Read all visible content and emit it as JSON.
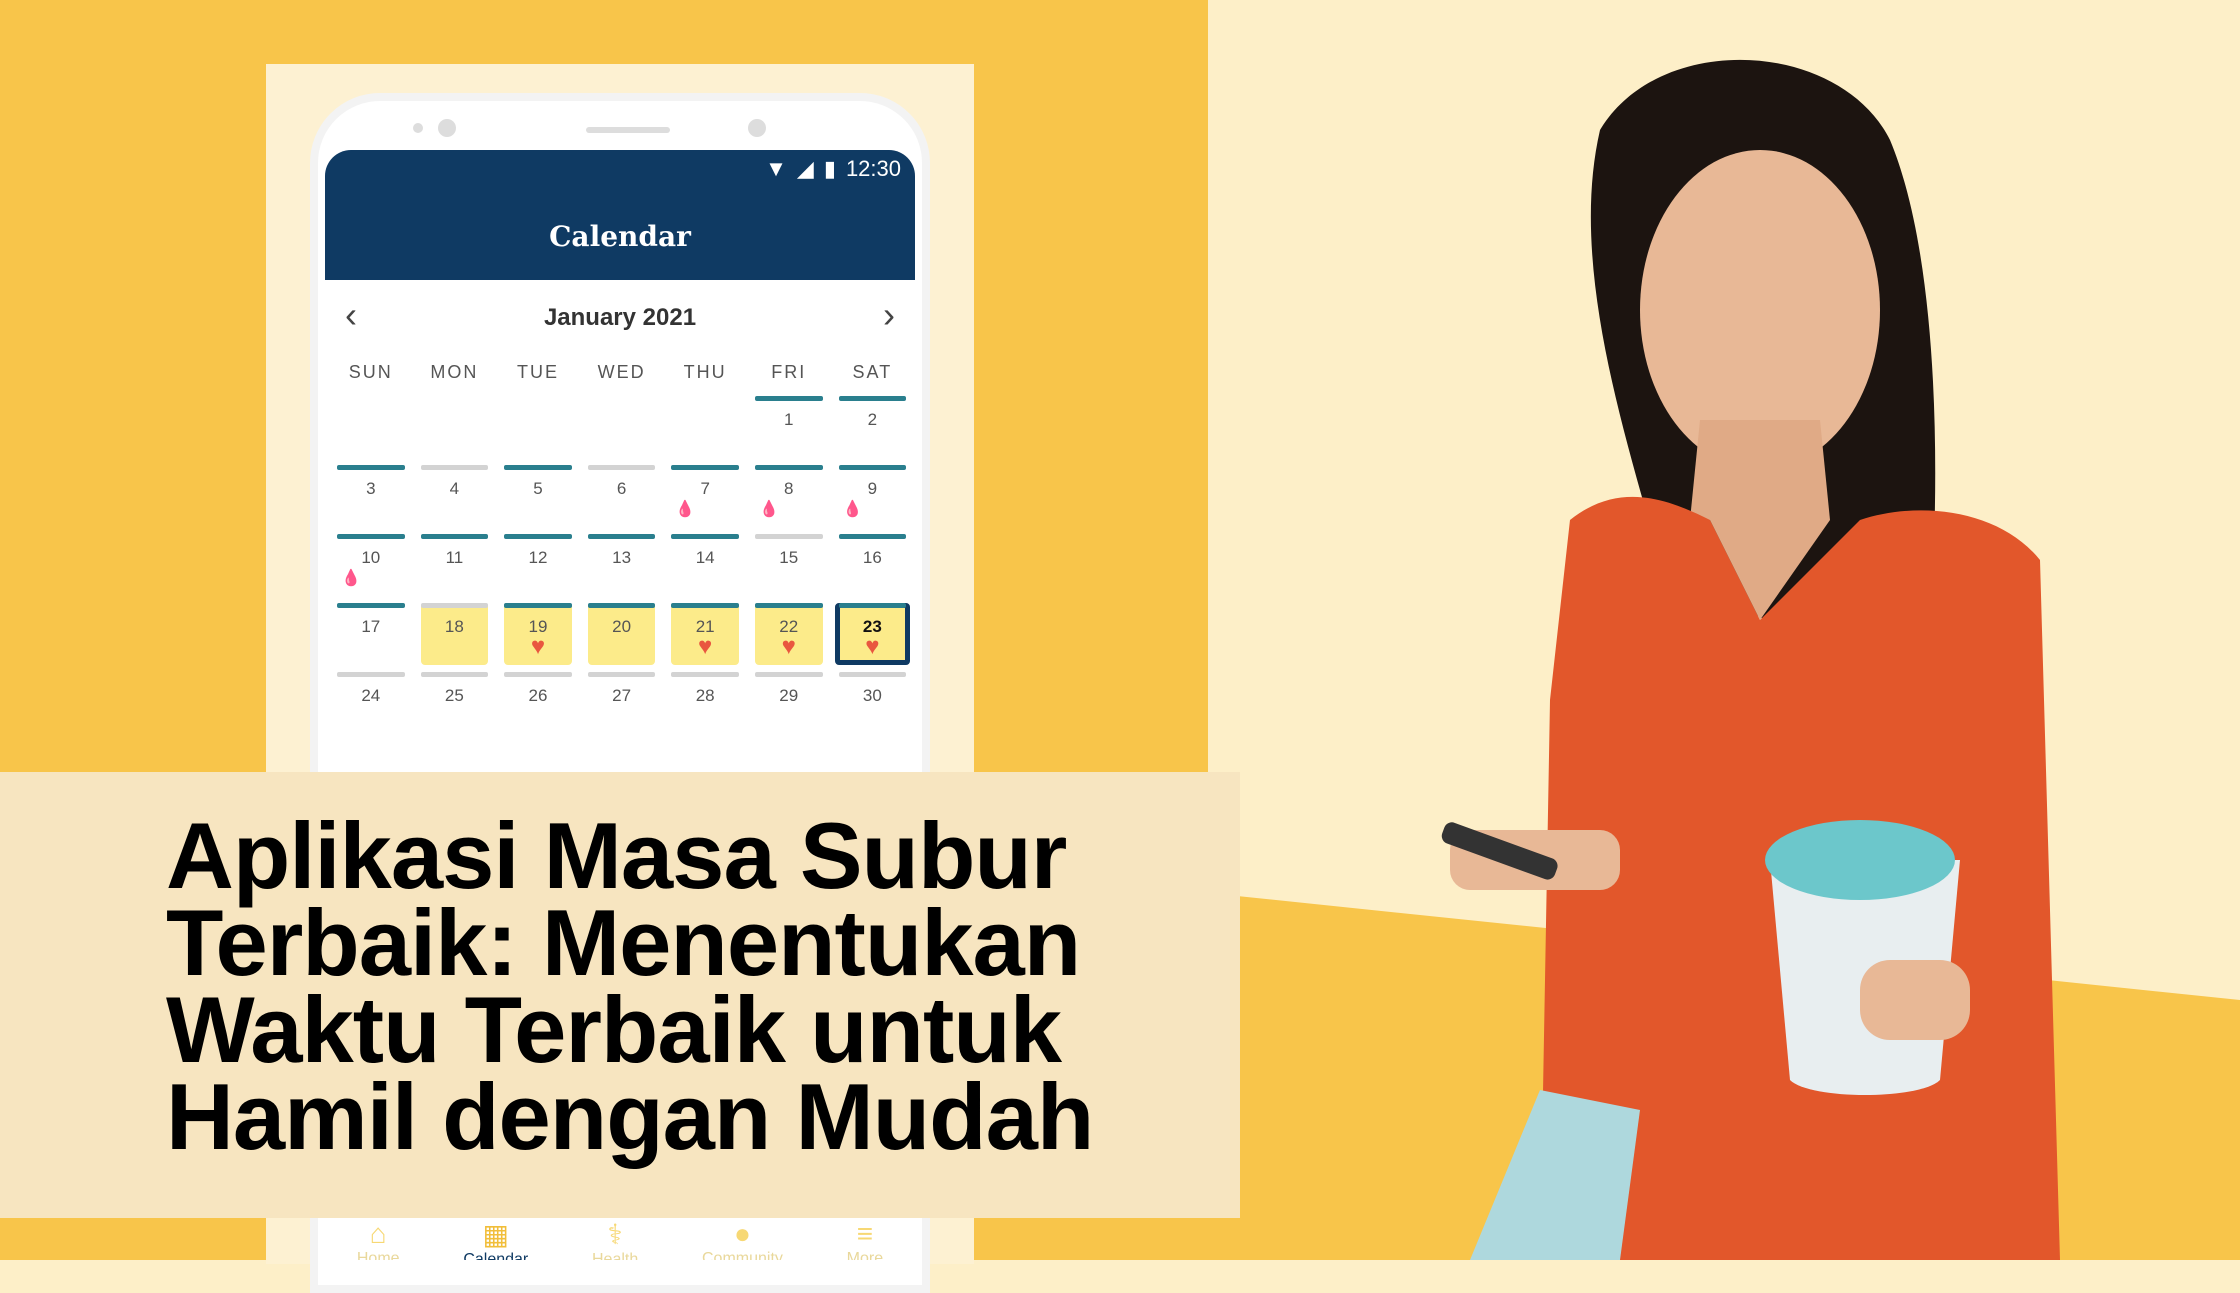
{
  "colors": {
    "left_bg": "#F8C54A",
    "right_bg": "#FDEFC8",
    "app_bar": "#0F3A63",
    "teal": "#2A7F8E",
    "gray": "#D3D3D3",
    "fertile": "#FCEB8A",
    "heart": "#E9573F",
    "drop": "#A11111"
  },
  "phone": {
    "status": {
      "time": "12:30",
      "icons": [
        "wifi-icon",
        "signal-icon",
        "battery-icon"
      ]
    },
    "app_title": "Calendar",
    "month": "January 2021",
    "prev_icon": "chevron-left-icon",
    "next_icon": "chevron-right-icon",
    "weekdays": [
      "SUN",
      "MON",
      "TUE",
      "WED",
      "THU",
      "FRI",
      "SAT"
    ],
    "days": [
      {
        "d": ""
      },
      {
        "d": ""
      },
      {
        "d": ""
      },
      {
        "d": ""
      },
      {
        "d": ""
      },
      {
        "d": "1",
        "bar": "teal"
      },
      {
        "d": "2",
        "bar": "teal"
      },
      {
        "d": "3",
        "bar": "teal"
      },
      {
        "d": "4",
        "bar": "gray"
      },
      {
        "d": "5",
        "bar": "teal"
      },
      {
        "d": "6",
        "bar": "gray"
      },
      {
        "d": "7",
        "bar": "teal",
        "drop": true
      },
      {
        "d": "8",
        "bar": "teal",
        "drop": true
      },
      {
        "d": "9",
        "bar": "teal",
        "drop": true
      },
      {
        "d": "10",
        "bar": "teal",
        "drop": true
      },
      {
        "d": "11",
        "bar": "teal"
      },
      {
        "d": "12",
        "bar": "teal"
      },
      {
        "d": "13",
        "bar": "teal"
      },
      {
        "d": "14",
        "bar": "teal"
      },
      {
        "d": "15",
        "bar": "gray"
      },
      {
        "d": "16",
        "bar": "teal"
      },
      {
        "d": "17",
        "bar": "teal"
      },
      {
        "d": "18",
        "bar": "gray",
        "fertile": true
      },
      {
        "d": "19",
        "bar": "teal",
        "fertile": true,
        "heart": true
      },
      {
        "d": "20",
        "bar": "teal",
        "fertile": true
      },
      {
        "d": "21",
        "bar": "teal",
        "fertile": true,
        "heart": true
      },
      {
        "d": "22",
        "bar": "teal",
        "fertile": true,
        "heart": true
      },
      {
        "d": "23",
        "bar": "teal",
        "fertile": true,
        "heart": true,
        "selected": true
      },
      {
        "d": "24",
        "bar": "gray"
      },
      {
        "d": "25",
        "bar": "gray"
      },
      {
        "d": "26",
        "bar": "gray"
      },
      {
        "d": "27",
        "bar": "gray"
      },
      {
        "d": "28",
        "bar": "gray"
      },
      {
        "d": "29",
        "bar": "gray"
      },
      {
        "d": "30",
        "bar": "gray"
      }
    ],
    "bottom_nav": [
      {
        "label": "Home",
        "icon": "home-icon"
      },
      {
        "label": "Calendar",
        "icon": "calendar-icon",
        "active": true
      },
      {
        "label": "Health",
        "icon": "stethoscope-icon"
      },
      {
        "label": "Community",
        "icon": "chat-icon"
      },
      {
        "label": "More",
        "icon": "menu-icon"
      }
    ]
  },
  "headline": {
    "lines": [
      "Aplikasi Masa Subur",
      "Terbaik: Menentukan",
      "Waktu Terbaik untuk",
      "Hamil dengan Mudah"
    ]
  }
}
